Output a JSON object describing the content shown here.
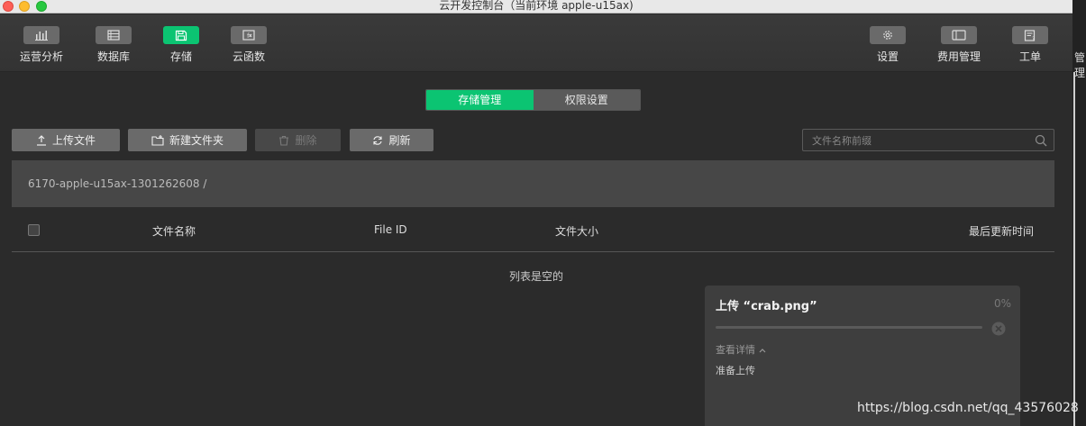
{
  "window": {
    "title": "云开发控制台（当前环境 apple-u15ax)"
  },
  "toolbar": {
    "left": [
      {
        "label": "运营分析",
        "icon": "bar-chart-icon"
      },
      {
        "label": "数据库",
        "icon": "database-icon"
      },
      {
        "label": "存储",
        "icon": "storage-icon",
        "active": true
      },
      {
        "label": "云函数",
        "icon": "function-icon"
      }
    ],
    "right": [
      {
        "label": "设置",
        "icon": "gear-icon"
      },
      {
        "label": "费用管理",
        "icon": "billing-icon"
      },
      {
        "label": "工单",
        "icon": "ticket-icon"
      }
    ],
    "clipped_label": "管理"
  },
  "tabs": [
    {
      "label": "存储管理",
      "active": true
    },
    {
      "label": "权限设置",
      "active": false
    }
  ],
  "actions": {
    "upload": "上传文件",
    "new_folder": "新建文件夹",
    "delete": "删除",
    "refresh": "刷新"
  },
  "search": {
    "placeholder": "文件名称前缀"
  },
  "breadcrumb": {
    "path": "6170-apple-u15ax-1301262608 /"
  },
  "table": {
    "columns": [
      "文件名称",
      "File ID",
      "文件大小",
      "最后更新时间"
    ],
    "empty_text": "列表是空的"
  },
  "upload_panel": {
    "title": "上传 “crab.png”",
    "percent_label": "0%",
    "progress": 0,
    "detail_toggle": "查看详情",
    "status": "准备上传"
  },
  "watermark": "https://blog.csdn.net/qq_43576028",
  "colors": {
    "accent": "#0bc472",
    "background": "#2b2b2b",
    "button": "#6a6a6a"
  }
}
